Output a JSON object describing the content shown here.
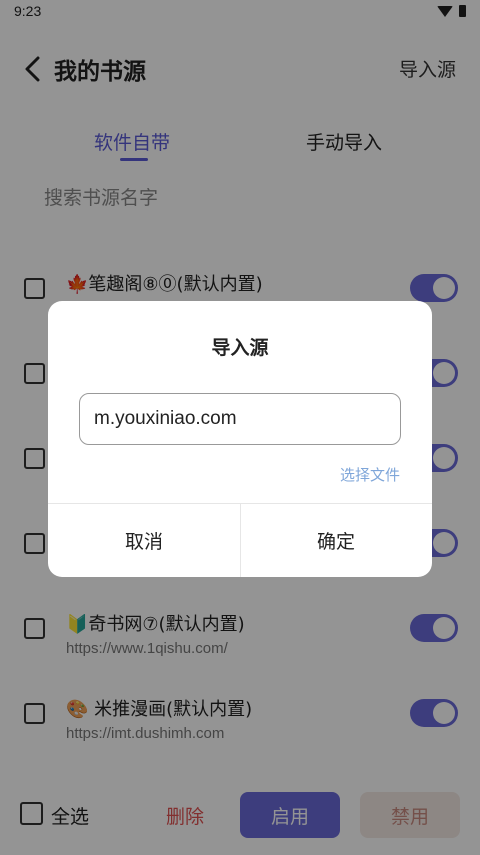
{
  "status": {
    "time": "9:23"
  },
  "header": {
    "title": "我的书源",
    "import_label": "导入源"
  },
  "tabs": [
    {
      "label": "软件自带",
      "active": true
    },
    {
      "label": "手动导入",
      "active": false
    }
  ],
  "search": {
    "placeholder": "搜索书源名字"
  },
  "sources": [
    {
      "name": "🍁笔趣阁⑧⓪(默认内置)",
      "url": "",
      "enabled": true
    },
    {
      "name": "",
      "url": "",
      "enabled": true
    },
    {
      "name": "",
      "url": "",
      "enabled": true
    },
    {
      "name": "",
      "url": "",
      "enabled": true
    },
    {
      "name": "🔰奇书网⑦(默认内置)",
      "url": "https://www.1qishu.com/",
      "enabled": true
    },
    {
      "name": "🎨 米推漫画(默认内置)",
      "url": "https://imt.dushimh.com",
      "enabled": true
    }
  ],
  "bottom": {
    "select_all": "全选",
    "delete": "删除",
    "enable": "启用",
    "disable": "禁用"
  },
  "dialog": {
    "title": "导入源",
    "input_value": "m.youxiniao.com",
    "choose_file": "选择文件",
    "cancel": "取消",
    "confirm": "确定"
  },
  "colors": {
    "accent": "#6a6ad8",
    "delete": "#e05252",
    "link": "#7fa6d9"
  }
}
